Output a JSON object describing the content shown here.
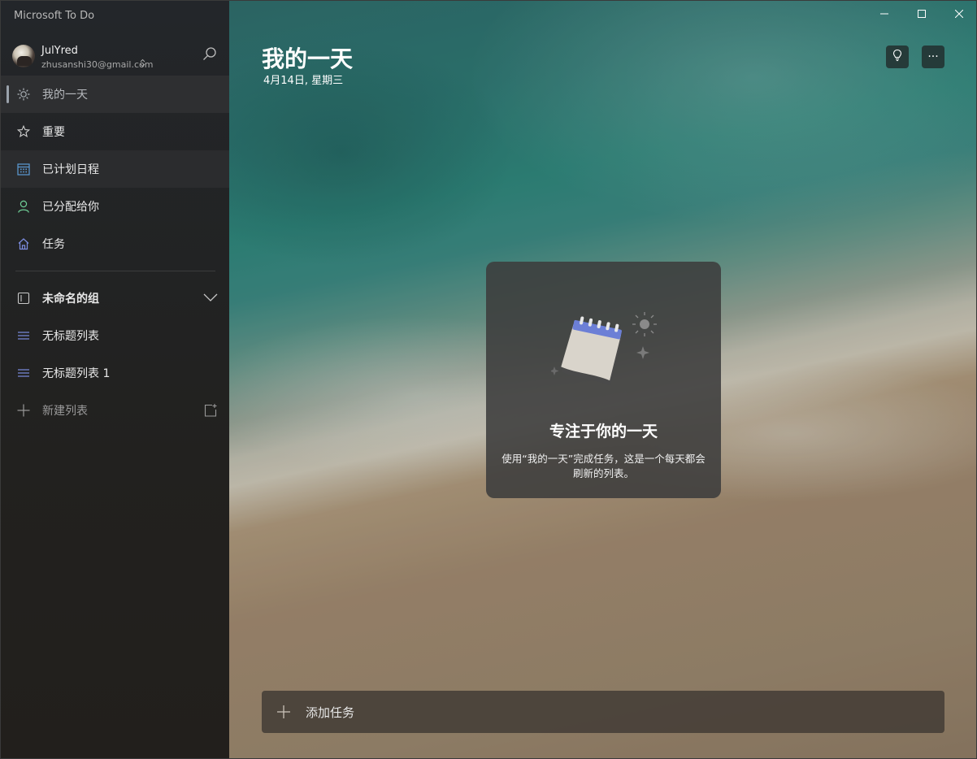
{
  "app": {
    "title": "Microsoft To Do"
  },
  "account": {
    "name": "JulYred",
    "email": "zhusanshi30@gmail.com",
    "chevron": "⌃⌄"
  },
  "sidebar": {
    "items": [
      {
        "label": "我的一天",
        "icon": "sun-icon"
      },
      {
        "label": "重要",
        "icon": "star-icon"
      },
      {
        "label": "已计划日程",
        "icon": "calendar-icon"
      },
      {
        "label": "已分配给你",
        "icon": "person-icon"
      },
      {
        "label": "任务",
        "icon": "home-icon"
      }
    ],
    "group": {
      "label": "未命名的组"
    },
    "lists": [
      {
        "label": "无标题列表"
      },
      {
        "label": "无标题列表 1"
      }
    ],
    "new_list_label": "新建列表"
  },
  "window": {
    "minimize": "─",
    "maximize": "☐",
    "close": "✕"
  },
  "main": {
    "title": "我的一天",
    "date": "4月14日, 星期三",
    "more_label": "···"
  },
  "empty_state": {
    "title": "专注于你的一天",
    "description": "使用“我的一天”完成任务，这是一个每天都会刷新的列表。"
  },
  "add_task": {
    "label": "添加任务"
  },
  "colors": {
    "sidebar_bg": "#23262a",
    "active_item_bg": "#2e2f31",
    "calendar_accent": "#5b9bd5",
    "person_accent": "#6fcf97",
    "home_accent": "#7b8ce0",
    "list_accent": "#7b8ce0"
  }
}
